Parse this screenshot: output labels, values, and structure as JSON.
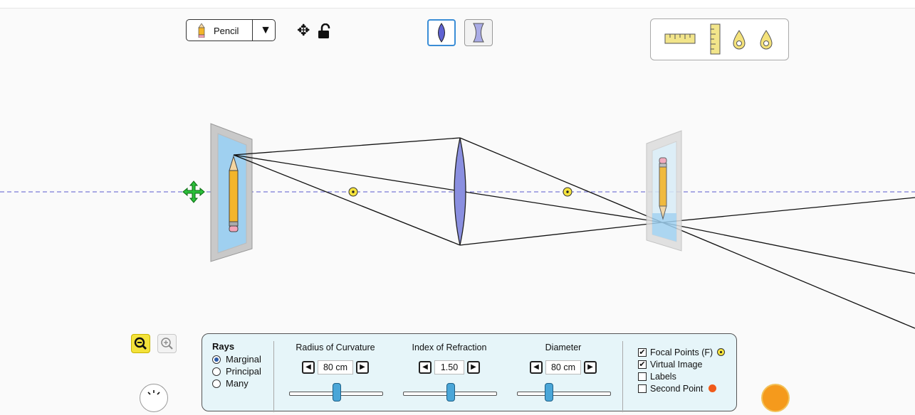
{
  "object_selector": {
    "selected": "Pencil",
    "arrow": "▼"
  },
  "lens_types": [
    "converging-lens",
    "diverging-lens"
  ],
  "tools": [
    "horizontal-ruler",
    "vertical-ruler",
    "light-source-1",
    "light-source-2"
  ],
  "panel": {
    "rays": {
      "title": "Rays",
      "options": [
        {
          "label": "Marginal",
          "selected": true
        },
        {
          "label": "Principal",
          "selected": false
        },
        {
          "label": "Many",
          "selected": false
        }
      ]
    },
    "controls": [
      {
        "title": "Radius of Curvature",
        "value": "80 cm"
      },
      {
        "title": "Index of Refraction",
        "value": "1.50"
      },
      {
        "title": "Diameter",
        "value": "80 cm"
      }
    ],
    "checkboxes": [
      {
        "label": "Focal Points (F)",
        "checked": true
      },
      {
        "label": "Virtual Image",
        "checked": true
      },
      {
        "label": "Labels",
        "checked": false
      },
      {
        "label": "Second Point",
        "checked": false
      }
    ]
  },
  "colors": {
    "accent": "#3a8dd6",
    "focal_point": "#f6e43d",
    "lens": "#8a8fe0",
    "axis": "#7b7bd6",
    "reset": "#f59a1c"
  }
}
